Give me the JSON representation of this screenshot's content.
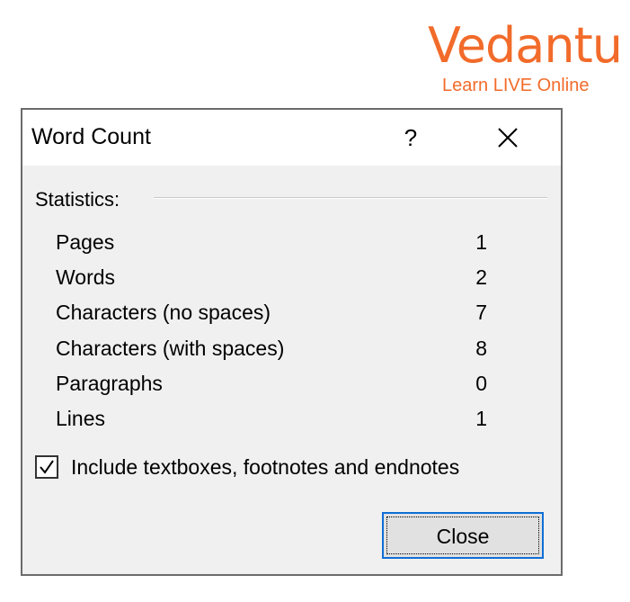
{
  "logo": {
    "wordmark": "Vedantu",
    "tagline": "Learn LIVE Online",
    "color": "#f26b2a"
  },
  "dialog": {
    "title": "Word Count",
    "help_label": "?",
    "close_icon": "close-icon",
    "section_label": "Statistics:",
    "stats": [
      {
        "label": "Pages",
        "value": "1"
      },
      {
        "label": "Words",
        "value": "2"
      },
      {
        "label": "Characters (no spaces)",
        "value": "7"
      },
      {
        "label": "Characters (with spaces)",
        "value": "8"
      },
      {
        "label": "Paragraphs",
        "value": "0"
      },
      {
        "label": "Lines",
        "value": "1"
      }
    ],
    "include_checkbox": {
      "label": "Include textboxes, footnotes and endnotes",
      "checked": true
    },
    "close_button_label": "Close",
    "focus_color": "#0f6fd6"
  }
}
